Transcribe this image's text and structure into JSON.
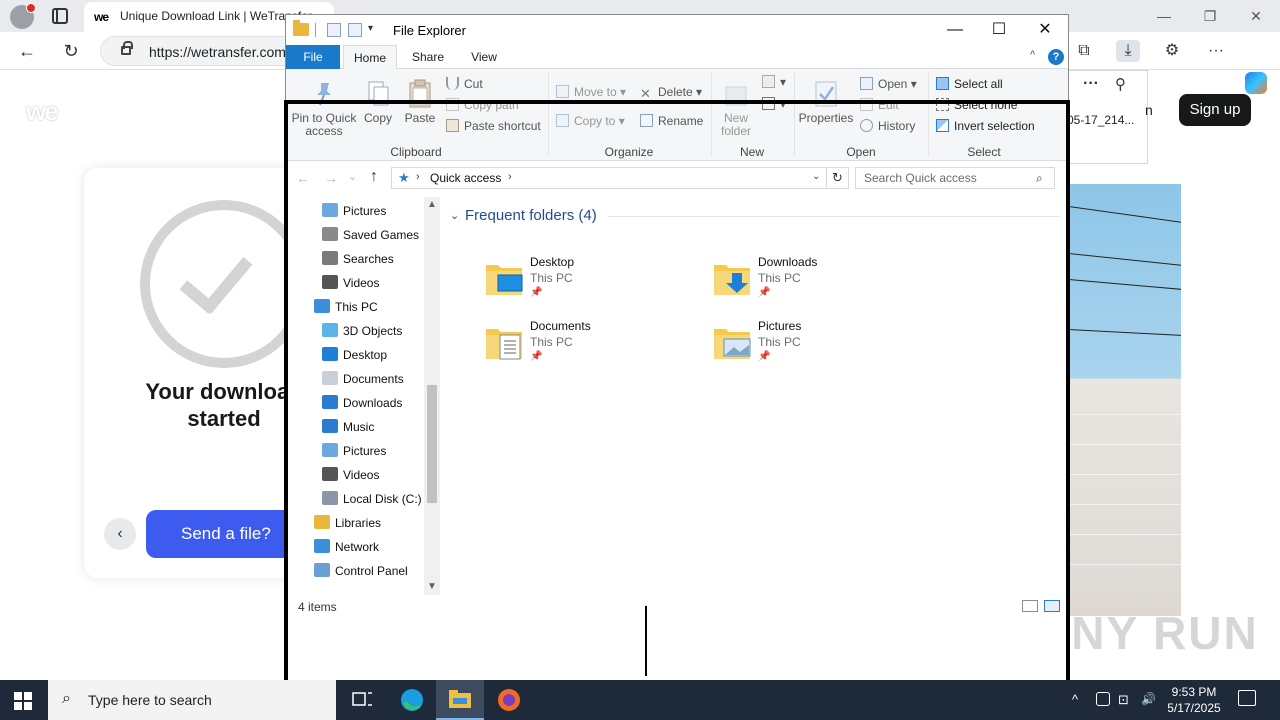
{
  "browser": {
    "tab_title": "Unique Download Link | WeTransfer",
    "tab_favicon": "we",
    "url": "https://wetransfer.com",
    "flyout_filename": "05-17_214...",
    "flyout_more": "···",
    "flyout_pin": "⚲",
    "nav_back": "←",
    "nav_reload": "↻",
    "tab_minimize": "—",
    "tab_maximize": "❐",
    "tab_close": "✕",
    "toolbar_collections": "⧉",
    "toolbar_download": "⤓",
    "toolbar_extensions": "⚙",
    "toolbar_more": "···"
  },
  "wetransfer": {
    "logo": "we",
    "signin_partial": "n",
    "signup": "Sign up",
    "download_started": "Your download started",
    "send_file": "Send a file?",
    "back_arrow": "‹",
    "watermark": "ANY RUN"
  },
  "explorer": {
    "title": "File Explorer",
    "qat_dropdown": "▾",
    "controls": {
      "minimize": "—",
      "maximize": "☐",
      "close": "✕"
    },
    "tabs": {
      "file": "File",
      "home": "Home",
      "share": "Share",
      "view": "View"
    },
    "ribbon_collapse": "^",
    "help": "?",
    "ribbon": {
      "pin_quick_access": "Pin to Quick access",
      "copy": "Copy",
      "paste": "Paste",
      "cut": "Cut",
      "copy_path": "Copy path",
      "paste_shortcut": "Paste shortcut",
      "clipboard": "Clipboard",
      "move_to": "Move to",
      "copy_to": "Copy to",
      "delete": "Delete",
      "rename": "Rename",
      "organize": "Organize",
      "new_folder": "New folder",
      "new": "New",
      "properties": "Properties",
      "open": "Open",
      "edit": "Edit",
      "history": "History",
      "open_group": "Open",
      "select_all": "Select all",
      "select_none": "Select none",
      "invert_selection": "Invert selection",
      "select_group": "Select"
    },
    "address": {
      "back": "←",
      "forward": "→",
      "recent": "⌄",
      "up": "↑",
      "star": "★",
      "chevron": "›",
      "path": "Quick access",
      "dropdown": "⌄",
      "refresh": "↻",
      "search_placeholder": "Search Quick access",
      "search_icon": "⌕"
    },
    "nav": [
      {
        "label": "Pictures",
        "icon": "pictures"
      },
      {
        "label": "Saved Games",
        "icon": "saved-games"
      },
      {
        "label": "Searches",
        "icon": "searches"
      },
      {
        "label": "Videos",
        "icon": "videos"
      },
      {
        "label": "This PC",
        "icon": "this-pc"
      },
      {
        "label": "3D Objects",
        "icon": "3d-objects"
      },
      {
        "label": "Desktop",
        "icon": "desktop"
      },
      {
        "label": "Documents",
        "icon": "documents"
      },
      {
        "label": "Downloads",
        "icon": "downloads"
      },
      {
        "label": "Music",
        "icon": "music"
      },
      {
        "label": "Pictures",
        "icon": "pictures"
      },
      {
        "label": "Videos",
        "icon": "videos"
      },
      {
        "label": "Local Disk (C:)",
        "icon": "local-disk"
      },
      {
        "label": "Libraries",
        "icon": "libraries"
      },
      {
        "label": "Network",
        "icon": "network"
      },
      {
        "label": "Control Panel",
        "icon": "control-panel"
      }
    ],
    "scroll_up": "▲",
    "scroll_down": "▼",
    "section_chevron": "⌄",
    "section_title": "Frequent folders (4)",
    "pin_glyph": "📌",
    "folders": [
      {
        "name": "Desktop",
        "location": "This PC",
        "icon": "desktop-folder"
      },
      {
        "name": "Downloads",
        "location": "This PC",
        "icon": "downloads-folder"
      },
      {
        "name": "Documents",
        "location": "This PC",
        "icon": "documents-folder"
      },
      {
        "name": "Pictures",
        "location": "This PC",
        "icon": "pictures-folder"
      }
    ],
    "status": "4 items"
  },
  "taskbar": {
    "search_icon": "⌕",
    "search_placeholder": "Type here to search",
    "time": "9:53 PM",
    "date": "5/17/2025",
    "tray_chevron": "^",
    "tray_network": "⊡",
    "tray_volume": "🔊"
  },
  "colors": {
    "accent": "#1979ca",
    "wetransfer_button": "#3e5bf0",
    "taskbar": "#1e2a3a",
    "folder": "#e8b73b"
  }
}
